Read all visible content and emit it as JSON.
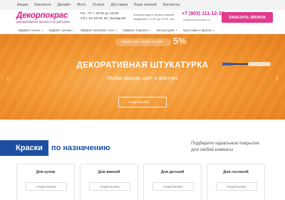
{
  "topnav": [
    "Акции",
    "Каталоги",
    "Дизайн",
    "Фото",
    "Услуги",
    "Доставка",
    "База знаний",
    "Контакты"
  ],
  "header": {
    "logo_name": "Декорпокрас",
    "logo_tagline": "декоративные краски и штукатурки",
    "hours_line1": "Пн - Пт с 10:00 до 19:00",
    "hours_line2": "Сб с 10-16-00, Вс: выходной",
    "consult_line1": "Консультация и прием заказов",
    "consult_line2": "ежедневно с 9:00 до 21:00, чат",
    "phone": "+7 (903) 111-12-33",
    "email": "mail@decorpokras.ru",
    "call_button": "ЗАКАЗАТЬ ЗВОНОК"
  },
  "catnav": [
    "Эффект песка",
    "Эффект шелка",
    "Эффект матовых стен",
    "Эффект бархата",
    "Штукатурки",
    "Грунтовки и краски"
  ],
  "hero": {
    "badge": "Скидка при заказе онлайн",
    "discount": "5%",
    "title": "ДЕКОРАТИВНАЯ ШТУКАТУРКА",
    "subtitle": "Любая форма, цвет и фактура",
    "button": "ПОДРОБНЕЕ",
    "button_arrow": "→",
    "prev_arrow": "‹",
    "next_arrow": "›",
    "colors": {
      "accent": "#f59a35",
      "pink": "#e23a8c",
      "blue": "#1c4fa1"
    }
  },
  "section": {
    "title_highlight": "Краски",
    "title_rest": "по назначению",
    "note_line1": "Подберите идеальное покрытие",
    "note_line2": "для любой комнаты",
    "cards": [
      {
        "title": "Для кухни",
        "button": "ПОДРОБНЕЕ"
      },
      {
        "title": "Для ванной",
        "button": "ПОДРОБНЕЕ"
      },
      {
        "title": "Для детской",
        "button": "ПОДРОБНЕЕ"
      },
      {
        "title": "Для гостиной",
        "button": "ПОДРОБНЕЕ"
      }
    ]
  }
}
